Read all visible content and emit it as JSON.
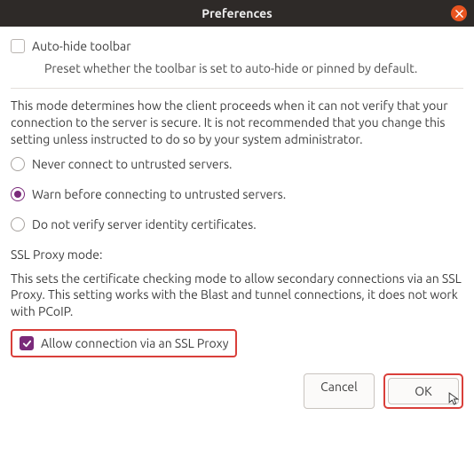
{
  "window": {
    "title": "Preferences"
  },
  "autohide": {
    "label": "Auto-hide toolbar",
    "checked": false,
    "description": "Preset whether the toolbar is set to auto-hide or pinned by default."
  },
  "security": {
    "description": "This mode determines how the client proceeds when it can not verify that your connection to the server is secure. It is not recommended that you change this setting unless instructed to do so by your system administrator.",
    "options": {
      "never": "Never connect to untrusted servers.",
      "warn": "Warn before connecting to untrusted servers.",
      "noverify": "Do not verify server identity certificates."
    },
    "selected": "warn"
  },
  "sslproxy": {
    "label": "SSL Proxy mode:",
    "description": "This sets the certificate checking mode to allow secondary connections via an SSL Proxy. This setting works with the Blast and tunnel connections, it does not work with PCoIP.",
    "checkbox_label": "Allow connection via an SSL Proxy",
    "checked": true
  },
  "buttons": {
    "cancel": "Cancel",
    "ok": "OK"
  }
}
